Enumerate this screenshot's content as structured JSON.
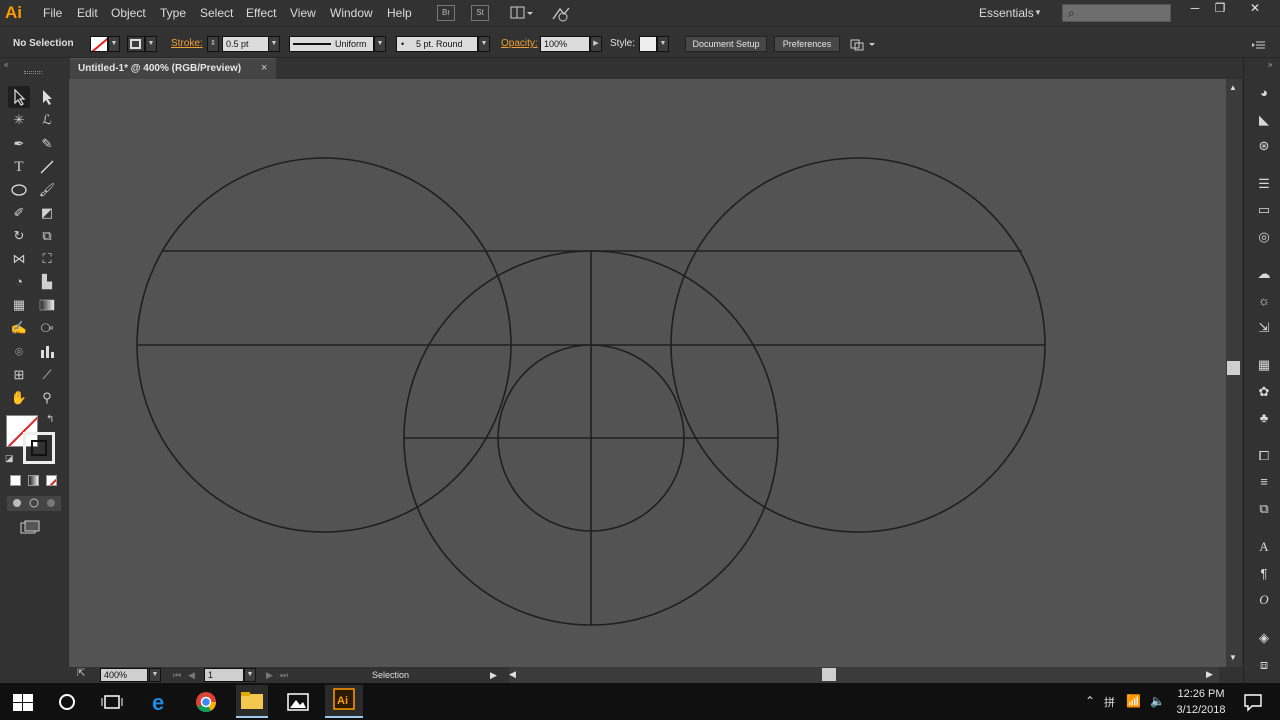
{
  "app": {
    "logo": "Ai",
    "menu": [
      "File",
      "Edit",
      "Object",
      "Type",
      "Select",
      "Effect",
      "View",
      "Window",
      "Help"
    ],
    "bridge_label": "Br",
    "stock_label": "St",
    "workspace": "Essentials",
    "window_controls": [
      "─",
      "❐",
      "✕"
    ]
  },
  "control_bar": {
    "selection_label": "No Selection",
    "stroke_label": "Stroke:",
    "stroke_value": "0.5 pt",
    "profile_label": "Uniform",
    "brush_label": "5 pt. Round",
    "opacity_label": "Opacity:",
    "opacity_value": "100%",
    "style_label": "Style:",
    "document_setup": "Document Setup",
    "preferences": "Preferences"
  },
  "document": {
    "tab_title": "Untitled-1* @ 400% (RGB/Preview)",
    "close": "×"
  },
  "status_bar": {
    "zoom": "400%",
    "artboard": "1",
    "tool_status": "Selection"
  },
  "taskbar": {
    "time": "12:26 PM",
    "date": "3/12/2018",
    "ime_label": "拼"
  },
  "colors": {
    "canvas": "#535353",
    "stroke": "#1f1f1f",
    "accent": "#ff9a00"
  }
}
